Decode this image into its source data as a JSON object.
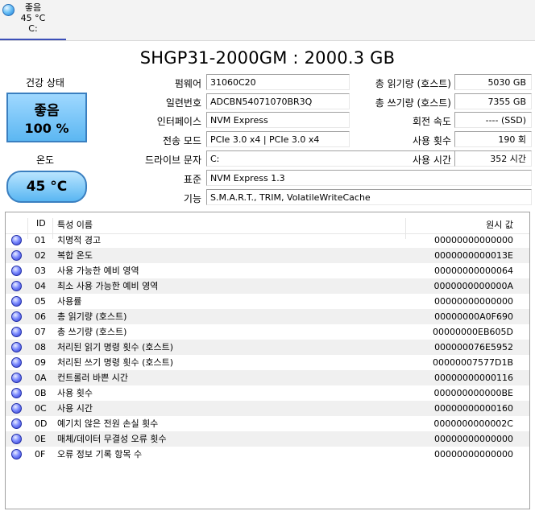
{
  "disk_tab": {
    "status": "좋음",
    "temp": "45 °C",
    "drive": "C:"
  },
  "title": "SHGP31-2000GM : 2000.3 GB",
  "health": {
    "label": "건강 상태",
    "status": "좋음",
    "percent": "100 %"
  },
  "temperature": {
    "label": "온도",
    "value": "45 °C"
  },
  "fields": {
    "firmware": {
      "label": "펌웨어",
      "value": "31060C20"
    },
    "serial": {
      "label": "일련번호",
      "value": "ADCBN54071070BR3Q"
    },
    "interface": {
      "label": "인터페이스",
      "value": "NVM Express"
    },
    "transfer": {
      "label": "전송 모드",
      "value": "PCIe 3.0 x4 | PCIe 3.0 x4"
    },
    "drive_letter": {
      "label": "드라이브 문자",
      "value": "C:"
    },
    "standard": {
      "label": "표준",
      "value": "NVM Express 1.3"
    },
    "features": {
      "label": "기능",
      "value": "S.M.A.R.T., TRIM, VolatileWriteCache"
    },
    "total_reads": {
      "label": "총 읽기량 (호스트)",
      "value": "5030 GB"
    },
    "total_writes": {
      "label": "총 쓰기량 (호스트)",
      "value": "7355 GB"
    },
    "rotation": {
      "label": "회전 속도",
      "value": "---- (SSD)"
    },
    "power_count": {
      "label": "사용 횟수",
      "value": "190 회"
    },
    "power_hours": {
      "label": "사용 시간",
      "value": "352 시간"
    }
  },
  "table": {
    "headers": {
      "id": "ID",
      "name": "특성 이름",
      "raw": "원시 값"
    },
    "rows": [
      {
        "id": "01",
        "name": "치명적 경고",
        "raw": "00000000000000"
      },
      {
        "id": "02",
        "name": "복합 온도",
        "raw": "0000000000013E"
      },
      {
        "id": "03",
        "name": "사용 가능한 예비 영역",
        "raw": "00000000000064"
      },
      {
        "id": "04",
        "name": "최소 사용 가능한 예비 영역",
        "raw": "0000000000000A"
      },
      {
        "id": "05",
        "name": "사용률",
        "raw": "00000000000000"
      },
      {
        "id": "06",
        "name": "총 읽기량 (호스트)",
        "raw": "00000000A0F690"
      },
      {
        "id": "07",
        "name": "총 쓰기량 (호스트)",
        "raw": "00000000EB605D"
      },
      {
        "id": "08",
        "name": "처리된 읽기 명령 횟수 (호스트)",
        "raw": "000000076E5952"
      },
      {
        "id": "09",
        "name": "처리된 쓰기 명령 횟수 (호스트)",
        "raw": "00000007577D1B"
      },
      {
        "id": "0A",
        "name": "컨트롤러 바쁜 시간",
        "raw": "00000000000116"
      },
      {
        "id": "0B",
        "name": "사용 횟수",
        "raw": "000000000000BE"
      },
      {
        "id": "0C",
        "name": "사용 시간",
        "raw": "00000000000160"
      },
      {
        "id": "0D",
        "name": "예기치 않은 전원 손실 횟수",
        "raw": "0000000000002C"
      },
      {
        "id": "0E",
        "name": "매체/데이터 무결성 오류 횟수",
        "raw": "00000000000000"
      },
      {
        "id": "0F",
        "name": "오류 정보 기록 항목 수",
        "raw": "00000000000000"
      }
    ]
  }
}
